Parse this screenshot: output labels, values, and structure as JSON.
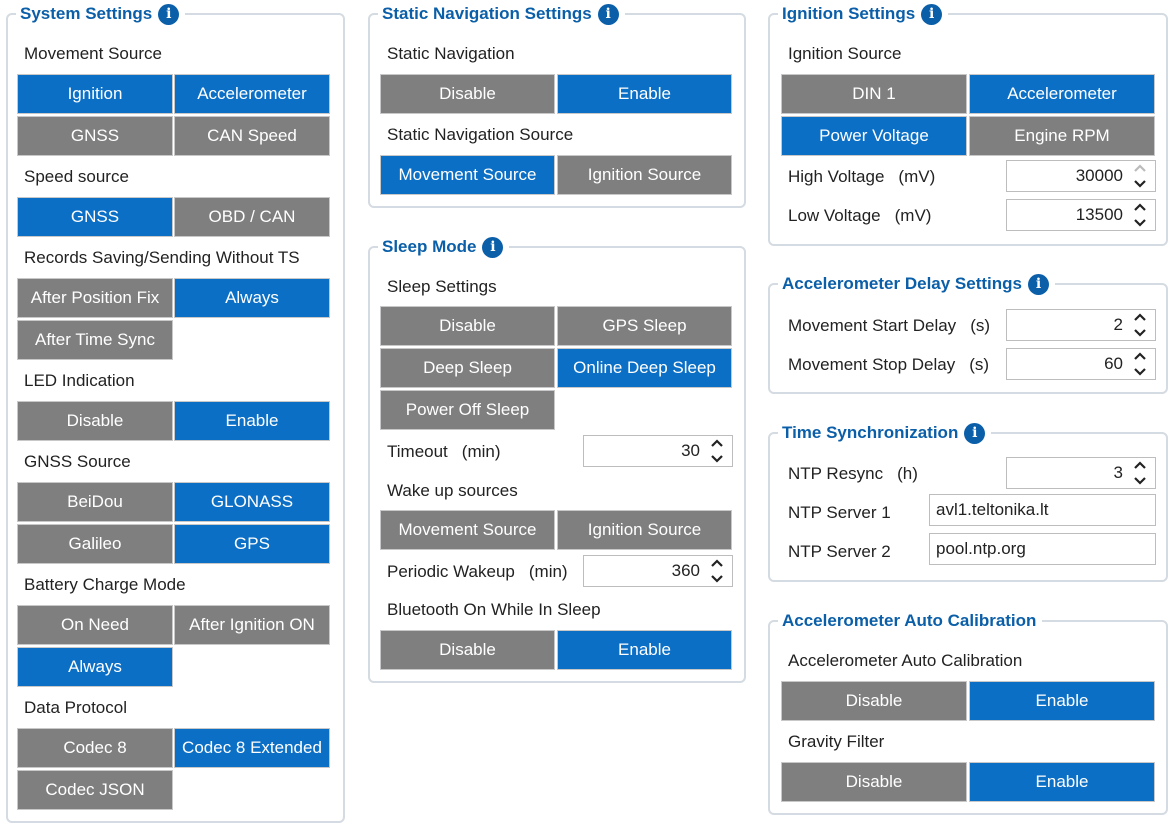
{
  "system_settings": {
    "title": "System Settings",
    "movement_source": {
      "label": "Movement Source",
      "options": [
        "Ignition",
        "Accelerometer",
        "GNSS",
        "CAN Speed"
      ]
    },
    "speed_source": {
      "label": "Speed source",
      "options": [
        "GNSS",
        "OBD / CAN"
      ]
    },
    "records_saving": {
      "label": "Records Saving/Sending Without TS",
      "options": [
        "After Position Fix",
        "Always",
        "After Time Sync"
      ]
    },
    "led_indication": {
      "label": "LED Indication",
      "options": [
        "Disable",
        "Enable"
      ]
    },
    "gnss_source": {
      "label": "GNSS Source",
      "options": [
        "BeiDou",
        "GLONASS",
        "Galileo",
        "GPS"
      ]
    },
    "battery_charge_mode": {
      "label": "Battery Charge Mode",
      "options": [
        "On Need",
        "After Ignition ON",
        "Always"
      ]
    },
    "data_protocol": {
      "label": "Data Protocol",
      "options": [
        "Codec 8",
        "Codec 8 Extended",
        "Codec JSON"
      ]
    }
  },
  "static_navigation": {
    "title": "Static Navigation Settings",
    "static_navigation": {
      "label": "Static Navigation",
      "options": [
        "Disable",
        "Enable"
      ]
    },
    "static_navigation_source": {
      "label": "Static Navigation Source",
      "options": [
        "Movement Source",
        "Ignition Source"
      ]
    }
  },
  "sleep_mode": {
    "title": "Sleep Mode",
    "sleep_settings": {
      "label": "Sleep Settings",
      "options": [
        "Disable",
        "GPS Sleep",
        "Deep Sleep",
        "Online Deep Sleep",
        "Power Off Sleep"
      ]
    },
    "timeout": {
      "label": "Timeout",
      "unit": "(min)",
      "value": "30"
    },
    "wake_up_sources": {
      "label": "Wake up sources",
      "options": [
        "Movement Source",
        "Ignition Source"
      ]
    },
    "periodic_wakeup": {
      "label": "Periodic Wakeup",
      "unit": "(min)",
      "value": "360"
    },
    "bluetooth_on_sleep": {
      "label": "Bluetooth On While In Sleep",
      "options": [
        "Disable",
        "Enable"
      ]
    }
  },
  "ignition_settings": {
    "title": "Ignition Settings",
    "ignition_source": {
      "label": "Ignition Source",
      "options": [
        "DIN 1",
        "Accelerometer",
        "Power Voltage",
        "Engine RPM"
      ]
    },
    "high_voltage": {
      "label": "High Voltage",
      "unit": "(mV)",
      "value": "30000"
    },
    "low_voltage": {
      "label": "Low Voltage",
      "unit": "(mV)",
      "value": "13500"
    }
  },
  "accel_delay": {
    "title": "Accelerometer Delay Settings",
    "movement_start_delay": {
      "label": "Movement Start Delay",
      "unit": "(s)",
      "value": "2"
    },
    "movement_stop_delay": {
      "label": "Movement Stop Delay",
      "unit": "(s)",
      "value": "60"
    }
  },
  "time_sync": {
    "title": "Time Synchronization",
    "ntp_resync": {
      "label": "NTP Resync",
      "unit": "(h)",
      "value": "3"
    },
    "ntp_server_1": {
      "label": "NTP Server 1",
      "value": "avl1.teltonika.lt"
    },
    "ntp_server_2": {
      "label": "NTP Server 2",
      "value": "pool.ntp.org"
    }
  },
  "accel_auto_calibration": {
    "title": "Accelerometer Auto Calibration",
    "auto_calibration": {
      "label": "Accelerometer Auto Calibration",
      "options": [
        "Disable",
        "Enable"
      ]
    },
    "gravity_filter": {
      "label": "Gravity Filter",
      "options": [
        "Disable",
        "Enable"
      ]
    }
  },
  "icons": {
    "info": "info-icon",
    "spinner": "up-down-arrows-icon"
  },
  "info_glyph": "i",
  "colors": {
    "title": "#0b5fa8",
    "selected": "#0b6fc6",
    "unselected": "#7f7f7f",
    "border": "#d5dbe2"
  }
}
